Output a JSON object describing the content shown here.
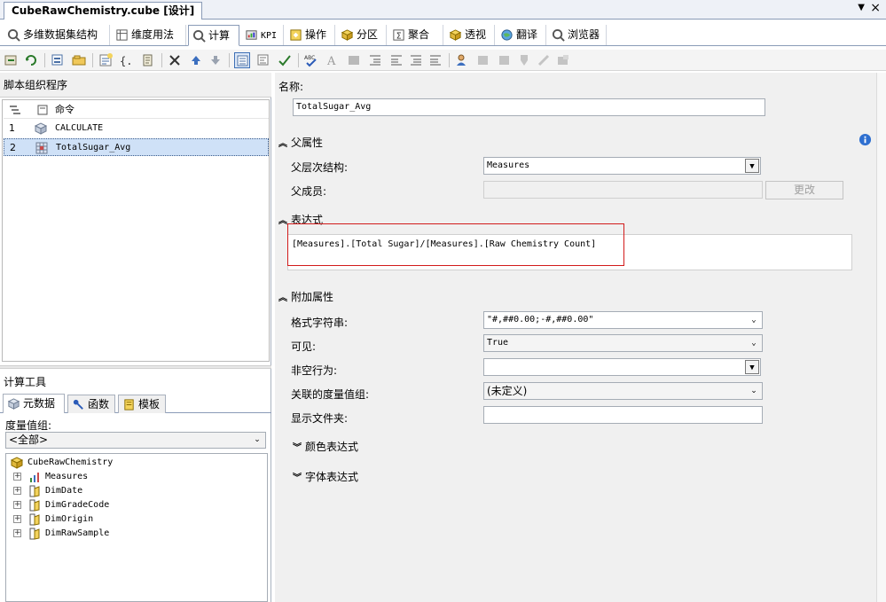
{
  "document": {
    "tab_title": "CubeRawChemistry.cube [设计]"
  },
  "designer_tabs": [
    {
      "label": "多维数据集结构",
      "icon": "cube-structure-icon"
    },
    {
      "label": "维度用法",
      "icon": "dimension-usage-icon"
    },
    {
      "label": "计算",
      "icon": "calculations-icon",
      "active": true
    },
    {
      "label": "KPI",
      "icon": "kpi-icon"
    },
    {
      "label": "操作",
      "icon": "actions-icon"
    },
    {
      "label": "分区",
      "icon": "partitions-icon"
    },
    {
      "label": "聚合",
      "icon": "aggregations-icon"
    },
    {
      "label": "透视",
      "icon": "perspectives-icon"
    },
    {
      "label": "翻译",
      "icon": "translations-icon"
    },
    {
      "label": "浏览器",
      "icon": "browser-icon"
    }
  ],
  "script_organizer": {
    "title": "脚本组织程序",
    "command_header": "命令",
    "rows": [
      {
        "num": "1",
        "text": "CALCULATE",
        "icon": "cube-script-icon"
      },
      {
        "num": "2",
        "text": "TotalSugar_Avg",
        "icon": "calculated-member-icon",
        "selected": true
      }
    ]
  },
  "calc_tools": {
    "title": "计算工具",
    "tabs": [
      {
        "label": "元数据",
        "icon": "metadata-icon",
        "active": true
      },
      {
        "label": "函数",
        "icon": "functions-icon"
      },
      {
        "label": "模板",
        "icon": "templates-icon"
      }
    ],
    "measure_group_label": "度量值组:",
    "measure_group_value": "<全部>",
    "tree_root": "CubeRawChemistry",
    "tree_items": [
      "Measures",
      "DimDate",
      "DimGradeCode",
      "DimOrigin",
      "DimRawSample"
    ]
  },
  "properties": {
    "name_label": "名称:",
    "name_value": "TotalSugar_Avg",
    "parent_section": "父属性",
    "parent_hierarchy_label": "父层次结构:",
    "parent_hierarchy_value": "Measures",
    "parent_member_label": "父成员:",
    "change_button": "更改",
    "expression_section": "表达式",
    "expression_value": "[Measures].[Total Sugar]/[Measures].[Raw Chemistry Count]",
    "additional_section": "附加属性",
    "format_string_label": "格式字符串:",
    "format_string_value": "\"#,##0.00;-#,##0.00\"",
    "visible_label": "可见:",
    "visible_value": "True",
    "non_empty_label": "非空行为:",
    "non_empty_value": "",
    "measure_group_label": "关联的度量值组:",
    "measure_group_value": "(未定义)",
    "display_folder_label": "显示文件夹:",
    "display_folder_value": "",
    "color_expr_section": "颜色表达式",
    "font_expr_section": "字体表达式"
  },
  "colors": {
    "accent": "#3d6fb5",
    "highlight_border": "#d21b1b",
    "selection": "#cfe1f7"
  }
}
